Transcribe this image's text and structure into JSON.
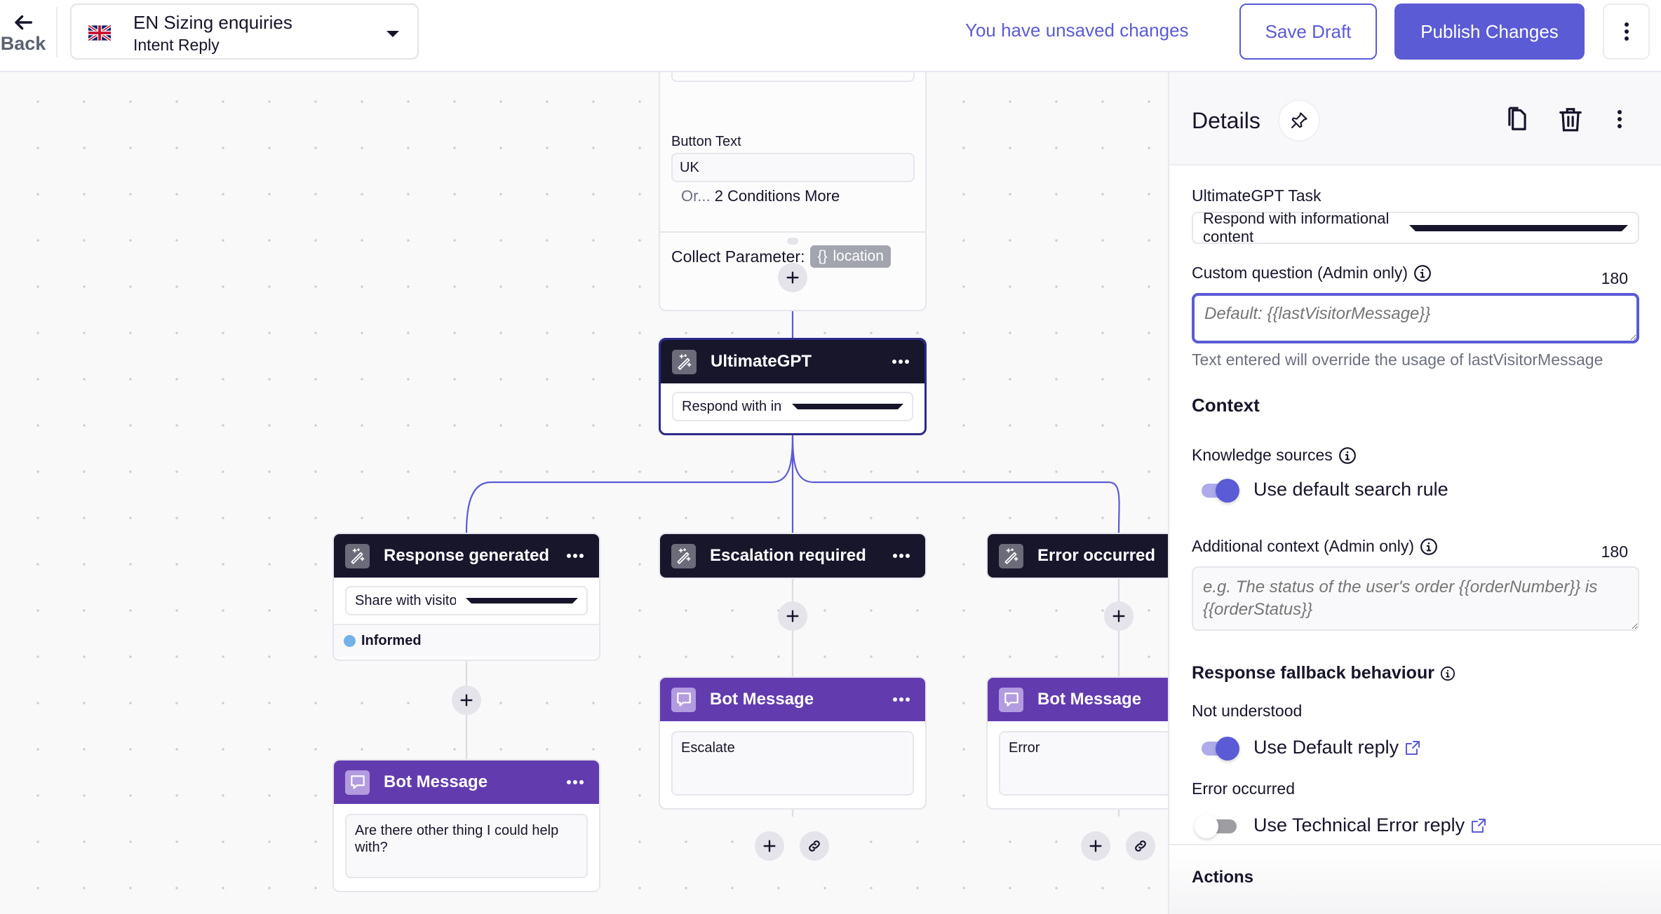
{
  "header": {
    "back_label": "Back",
    "flow": {
      "title": "EN Sizing enquiries",
      "subtitle": "Intent Reply",
      "flag_icon": "uk-flag-icon"
    },
    "unsaved_text": "You have unsaved changes",
    "save_draft_label": "Save Draft",
    "publish_label": "Publish Changes"
  },
  "canvas": {
    "top_node": {
      "button_text_label": "Button Text",
      "button_text_value": "UK",
      "or_prefix": "Or...",
      "more_conditions": "2 Conditions More",
      "collect_label": "Collect Parameter:",
      "param_icon": "{}",
      "param_name": "location"
    },
    "gpt_node": {
      "title": "UltimateGPT",
      "select_value": "Respond with informationa..."
    },
    "branches": [
      {
        "title": "Response generated",
        "select_value": "Share with visitor",
        "status": "Informed",
        "status_color": "#74b1e8",
        "message_title": "Bot Message",
        "message_text": "Are there other thing I could help with?"
      },
      {
        "title": "Escalation required",
        "message_title": "Bot Message",
        "message_text": "Escalate"
      },
      {
        "title": "Error occurred",
        "message_title": "Bot Message",
        "message_text": "Error"
      }
    ]
  },
  "details": {
    "title": "Details",
    "task_label": "UltimateGPT Task",
    "task_value": "Respond with informational content",
    "custom_question_label": "Custom question (Admin only)",
    "custom_question_counter": "180",
    "custom_question_value": "",
    "custom_question_placeholder": "Default: {{lastVisitorMessage}}",
    "custom_question_help": "Text entered will override the usage of lastVisitorMessage",
    "context_heading": "Context",
    "knowledge_label": "Knowledge sources",
    "knowledge_toggle_label": "Use default search rule",
    "knowledge_toggle_on": true,
    "additional_context_label": "Additional context (Admin only)",
    "additional_context_counter": "180",
    "additional_context_value": "",
    "additional_context_placeholder": "e.g. The status of the user's order {{orderNumber}} is {{orderStatus}}",
    "fallback_heading": "Response fallback behaviour",
    "not_understood_label": "Not understood",
    "default_reply_label": "Use Default reply",
    "default_reply_on": true,
    "error_occurred_label": "Error occurred",
    "tech_error_label": "Use Technical Error reply",
    "tech_error_on": false,
    "actions_label": "Actions"
  },
  "colors": {
    "accent": "#5b5bd6",
    "node_dark": "#17162b",
    "node_purple": "#623cae"
  }
}
